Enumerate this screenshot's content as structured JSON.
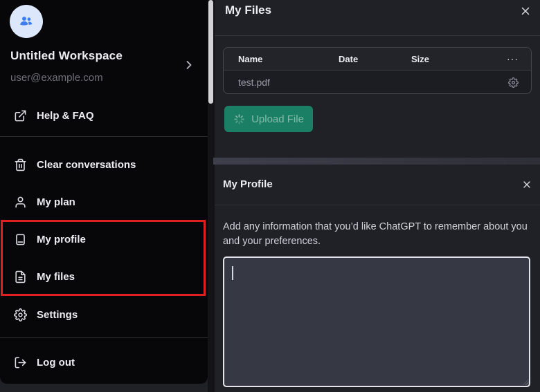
{
  "colors": {
    "menu_bg": "#07070a",
    "panel_bg": "#202127",
    "accent_green": "#1a7f64",
    "highlight_red": "#e02020",
    "muted_text": "#8e8ea0",
    "avatar_bg": "#dce7fb",
    "avatar_icon_blue": "#3f7ef0"
  },
  "sidebar": {
    "workspace": {
      "name": "Untitled Workspace",
      "email": "user@example.com",
      "avatar_icon": "people-group-icon",
      "chevron_icon": "chevron-right-icon"
    },
    "help": {
      "label": "Help & FAQ",
      "icon": "external-link-icon"
    },
    "menu": [
      {
        "label": "Clear conversations",
        "icon": "trash-icon"
      },
      {
        "label": "My plan",
        "icon": "user-icon"
      },
      {
        "label": "My profile",
        "icon": "book-icon",
        "highlighted": true
      },
      {
        "label": "My files",
        "icon": "file-text-icon",
        "highlighted": true
      },
      {
        "label": "Settings",
        "icon": "gear-icon"
      }
    ],
    "logout": {
      "label": "Log out",
      "icon": "log-out-icon"
    }
  },
  "files_panel": {
    "title": "My Files",
    "close_icon": "close-icon",
    "table": {
      "headers": {
        "name": "Name",
        "date": "Date",
        "size": "Size",
        "more": "···"
      },
      "rows": [
        {
          "name": "test.pdf",
          "date": "",
          "size": "",
          "action_icon": "gear-icon"
        }
      ]
    },
    "upload_button": {
      "label": "Upload File",
      "icon": "spinner-icon",
      "state": "loading"
    }
  },
  "profile_panel": {
    "title": "My Profile",
    "close_icon": "close-icon",
    "description": "Add any information that you’d like ChatGPT to remember about you and your preferences.",
    "textarea_value": ""
  }
}
